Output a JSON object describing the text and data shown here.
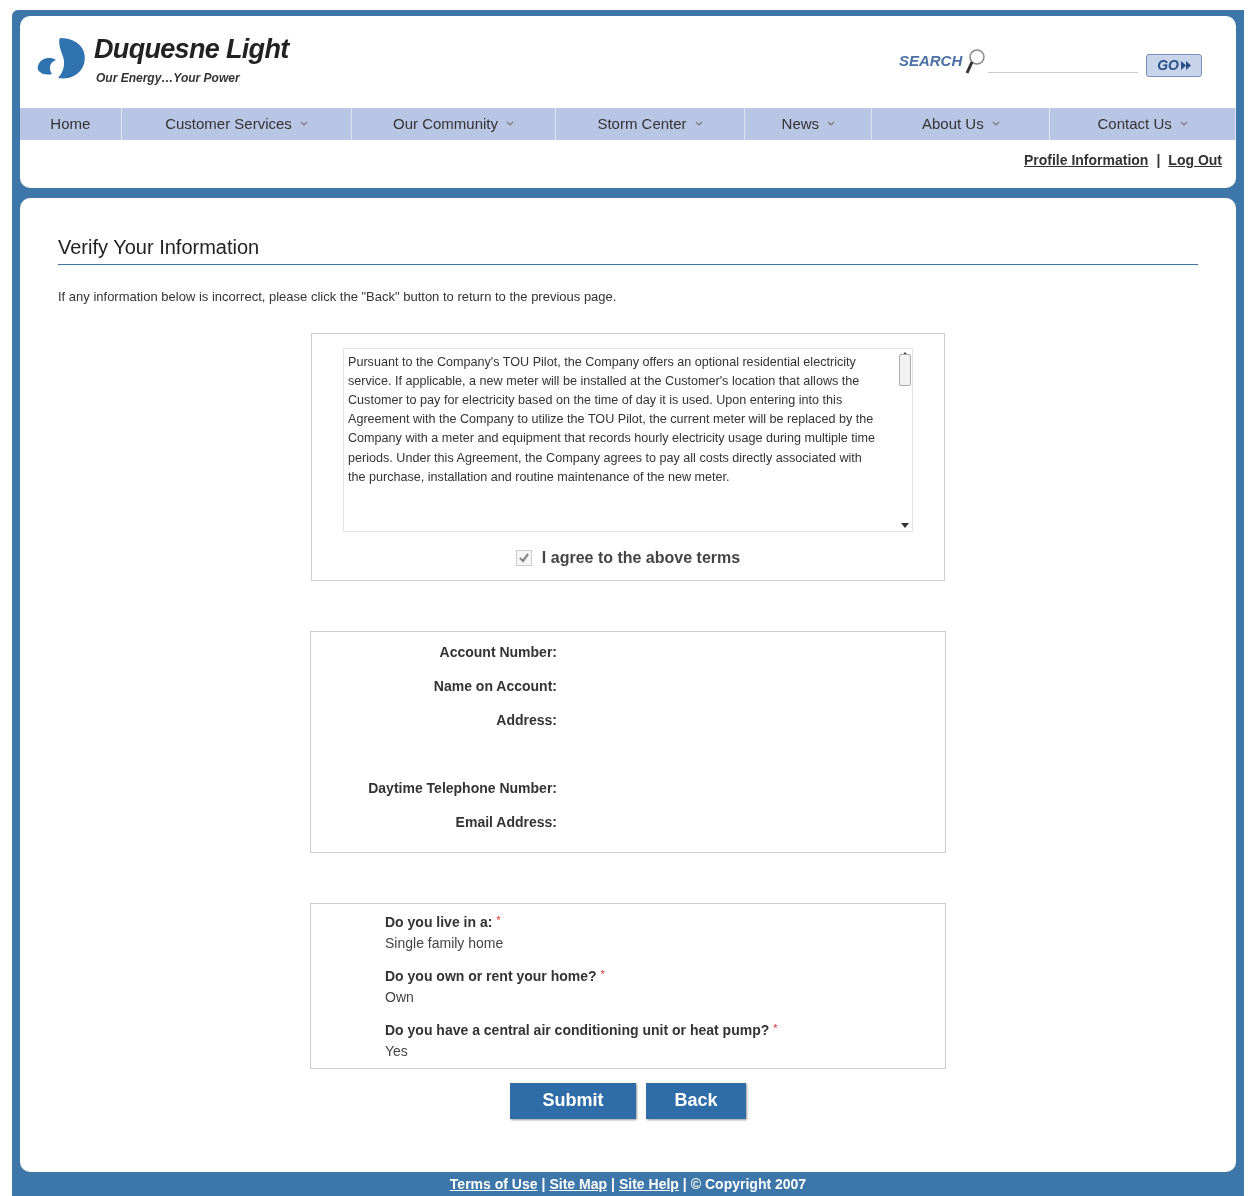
{
  "header": {
    "logo_name": "Duquesne Light",
    "tagline": "Our Energy…Your Power",
    "search": {
      "label": "SEARCH",
      "button": "GO"
    }
  },
  "nav": [
    {
      "label": "Home",
      "dropdown": false
    },
    {
      "label": "Customer Services",
      "dropdown": true
    },
    {
      "label": "Our Community",
      "dropdown": true
    },
    {
      "label": "Storm Center",
      "dropdown": true
    },
    {
      "label": "News",
      "dropdown": true
    },
    {
      "label": "About Us",
      "dropdown": true
    },
    {
      "label": "Contact Us",
      "dropdown": true
    }
  ],
  "user_links": [
    "Profile Information",
    "Log Out"
  ],
  "user_links_separator": "|",
  "page": {
    "title": "Verify Your Information",
    "intro": "If any information below is incorrect, please click the \"Back\" button to return to the previous page.",
    "terms": {
      "text": "Pursuant to the Company's TOU Pilot, the Company offers an optional residential electricity service.  If applicable, a new meter will be installed at the Customer's location that allows the Customer to pay for electricity based on the time of day it is used.  Upon entering into this Agreement with the Company to utilize the TOU Pilot, the current meter will be replaced by the Company with a meter and equipment that records hourly electricity usage during multiple time periods.  Under this Agreement, the Company agrees to pay all costs directly associated with the purchase, installation and routine maintenance of the new meter.",
      "agree_label": "I agree to the above terms",
      "checked": true,
      "disabled": true
    },
    "account_fields": [
      {
        "label": "Account Number:",
        "tall": false
      },
      {
        "label": "Name on Account:",
        "tall": false
      },
      {
        "label": "Address:",
        "tall": true
      },
      {
        "label": "Daytime Telephone Number:",
        "tall": false
      },
      {
        "label": "Email Address:",
        "tall": false
      }
    ],
    "questions": [
      {
        "question": "Do you live in a:",
        "required_mark": "*",
        "answer": "Single family home"
      },
      {
        "question": "Do you own or rent your home?",
        "required_mark": "*",
        "answer": "Own"
      },
      {
        "question": "Do you have a central air conditioning unit or heat pump?",
        "required_mark": "*",
        "answer": "Yes"
      }
    ],
    "buttons": [
      "Submit",
      "Back"
    ]
  },
  "footer": {
    "links": [
      "Terms of Use",
      "Site Map",
      "Site Help"
    ],
    "separator": "|",
    "copyright": "© Copyright 2007"
  }
}
